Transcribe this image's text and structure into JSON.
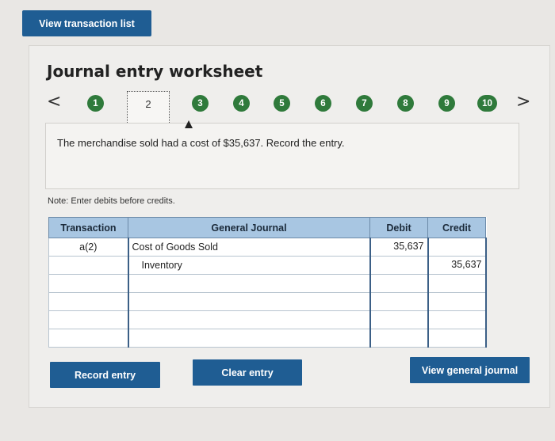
{
  "top": {
    "view_list_label": "View transaction list"
  },
  "worksheet": {
    "title": "Journal entry worksheet",
    "prev_arrow": "<",
    "next_arrow": ">",
    "steps": [
      "1",
      "2",
      "3",
      "4",
      "5",
      "6",
      "7",
      "8",
      "9",
      "10"
    ],
    "current_step": "2",
    "description": "The merchandise sold had a cost of $35,637. Record the entry.",
    "note": "Note: Enter debits before credits."
  },
  "table": {
    "headers": {
      "transaction": "Transaction",
      "general_journal": "General Journal",
      "debit": "Debit",
      "credit": "Credit"
    },
    "rows": [
      {
        "transaction": "a(2)",
        "account": "Cost of Goods Sold",
        "debit": "35,637",
        "credit": ""
      },
      {
        "transaction": "",
        "account": "Inventory",
        "debit": "",
        "credit": "35,637"
      },
      {
        "transaction": "",
        "account": "",
        "debit": "",
        "credit": ""
      },
      {
        "transaction": "",
        "account": "",
        "debit": "",
        "credit": ""
      },
      {
        "transaction": "",
        "account": "",
        "debit": "",
        "credit": ""
      },
      {
        "transaction": "",
        "account": "",
        "debit": "",
        "credit": ""
      }
    ]
  },
  "buttons": {
    "record": "Record entry",
    "clear": "Clear entry",
    "view_journal": "View general journal"
  },
  "colors": {
    "primary": "#1f5d93",
    "step_green": "#2f7a3b",
    "header_blue": "#a8c6e2"
  }
}
